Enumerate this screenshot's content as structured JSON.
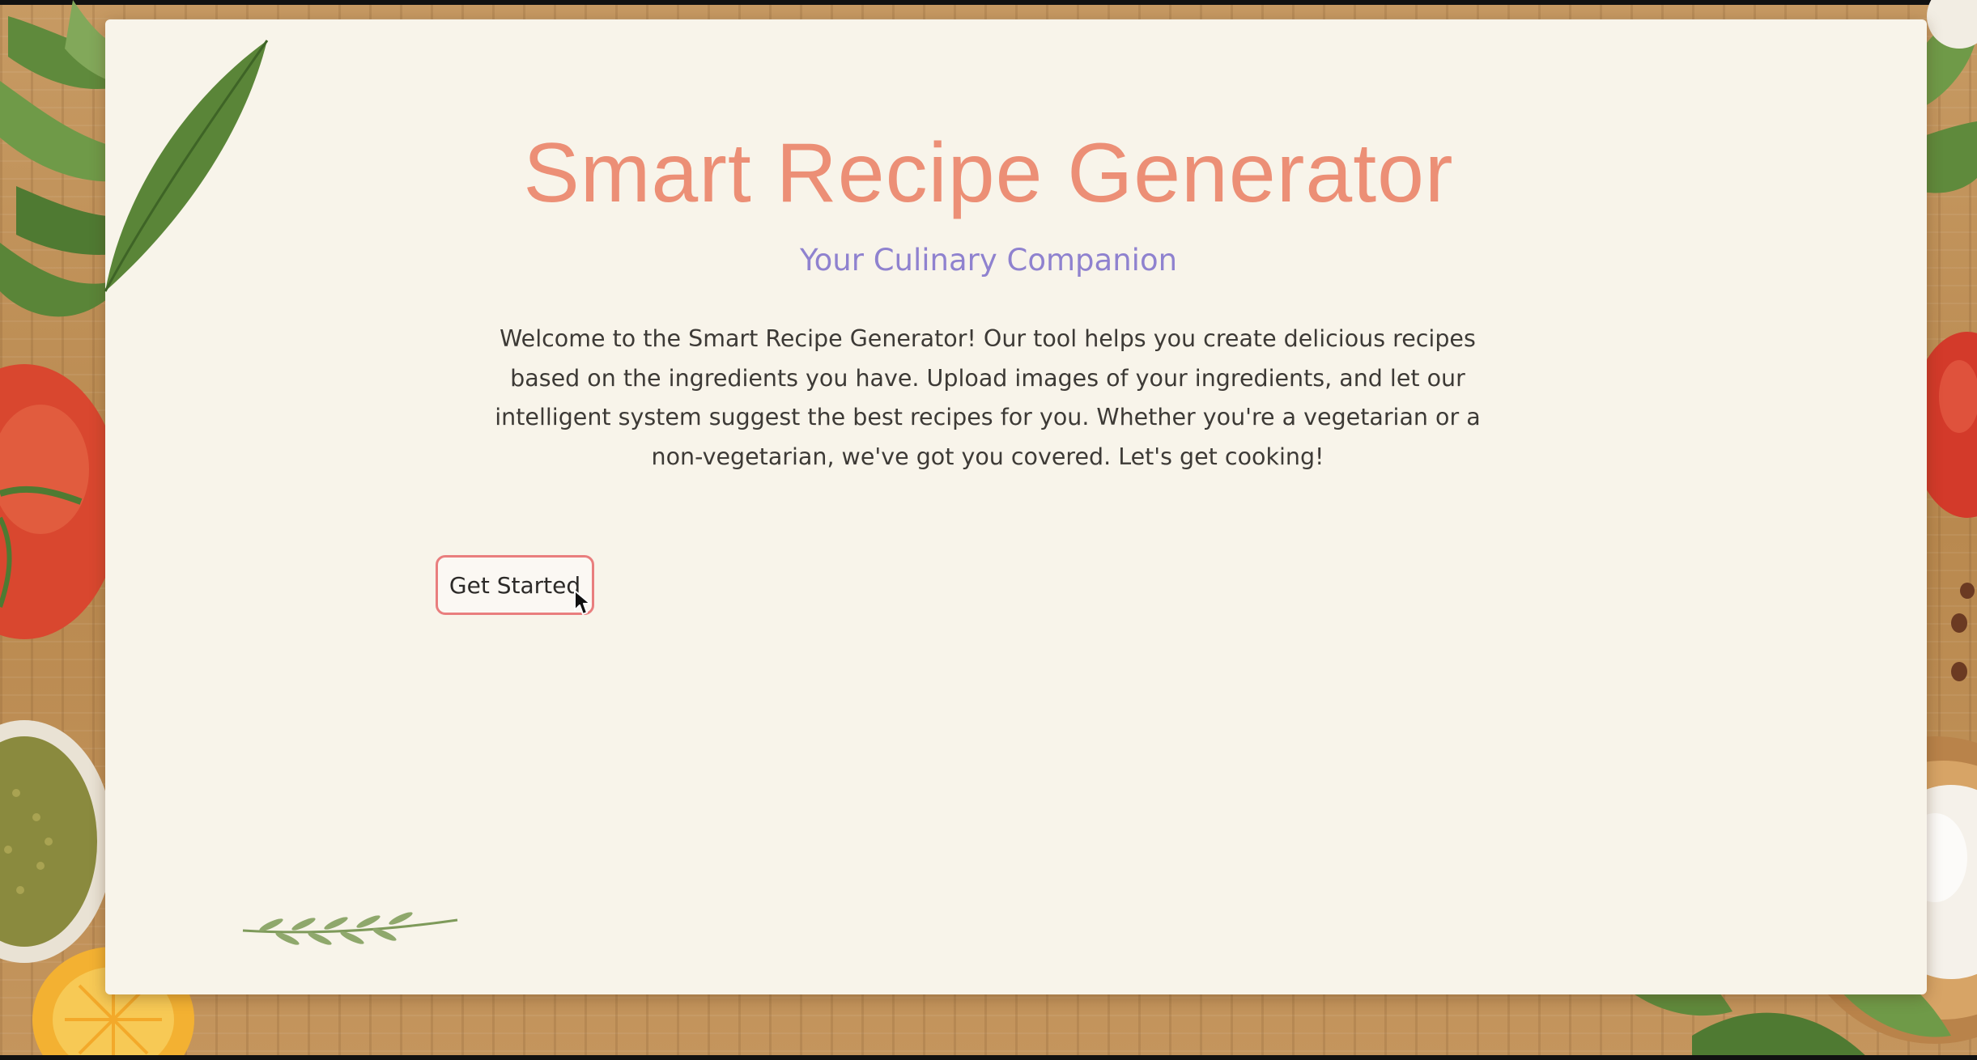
{
  "hero": {
    "title": "Smart Recipe Generator",
    "subtitle": "Your Culinary Companion",
    "welcome_text": "Welcome to the Smart Recipe Generator! Our tool helps you create delicious recipes based on the ingredients you have. Upload images of your ingredients, and let our intelligent system suggest the best recipes for you. Whether you're a vegetarian or a non-vegetarian, we've got you covered. Let's get cooking!",
    "cta_label": "Get Started"
  },
  "colors": {
    "title": "#ec8f76",
    "subtitle": "#8f82cf",
    "button_border": "#e97e7e",
    "paper": "#f8f4ea",
    "wood": "#c79a63"
  },
  "icons": {
    "cursor": "mouse-pointer-icon",
    "decorations": [
      "rosemary-sprig-icon",
      "leaf-icon",
      "tomato-icon",
      "mushroom-icon",
      "spice-bowl-icon",
      "egg-bowl-icon",
      "lemon-icon",
      "peppercorn-icon"
    ]
  }
}
